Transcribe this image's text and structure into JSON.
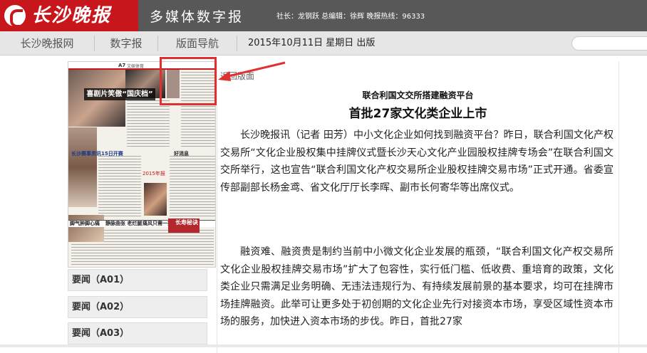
{
  "header": {
    "logo_text": "长沙晚报",
    "sub_brand": "多媒体数字报",
    "staff_info": "社长：龙钢跃 总编辑：徐辉 晚报热线：96333"
  },
  "nav": {
    "items": [
      "长沙晚报网",
      "数字报",
      "版面导航"
    ],
    "date": "2015年10月11日 星期日 出版"
  },
  "thumbnail": {
    "page_tag": "A7",
    "section_tag": "文娱体育",
    "headline": "喜剧片笑傲“国庆档”",
    "mid_head_1": "长沙赛事资讯15日开赛",
    "mid_head_2": "好消息",
    "mid_head_3": "2015年报",
    "bottom_1": "脚气肿脚心痛",
    "bottom_2": "静脉曲张 老烂腿",
    "bottom_3": "痛风只需一抹",
    "bottom_red": "长寿秘诀"
  },
  "sections": [
    "要闻（A01）",
    "要闻（A02）",
    "要闻（A03）"
  ],
  "article": {
    "back_link": "返回版面",
    "kicker": "联合利国文交所搭建融资平台",
    "headline": "首批27家文化类企业上市",
    "paragraphs": [
      "长沙晚报讯（记者 田芳）中小文化企业如何找到融资平台？昨日，联合利国文化产权交易所“文化企业股权集中挂牌仪式暨长沙天心文化产业园股权挂牌专场会”在联合利国文交所举行，这也宣告“联合利国文化产权交易所企业股权挂牌交易市场”正式开通。省委宣传部副部长杨金鸢、省文化厅厅长李晖、副市长何寄华等出席仪式。",
      "融资难、融资贵是制约当前中小微文化企业发展的瓶颈，“联合利国文化产权交易所文化企业股权挂牌交易市场”扩大了包容性，实行低门槛、低收费、重培育的政策，文化类企业只需满足业务明确、无违法违规行为、有持续发展前景的基本要求，均可在挂牌市场挂牌融资。此举可让更多处于初创期的文化企业先行对接资本市场，享受区域性资本市场的服务，加快进入资本市场的步伐。昨日，首批27家"
    ]
  },
  "colors": {
    "brand_red": "#c8161d",
    "header_gray": "#585858",
    "nav_bg": "#e6e6e6",
    "highlight": "#e03030"
  }
}
